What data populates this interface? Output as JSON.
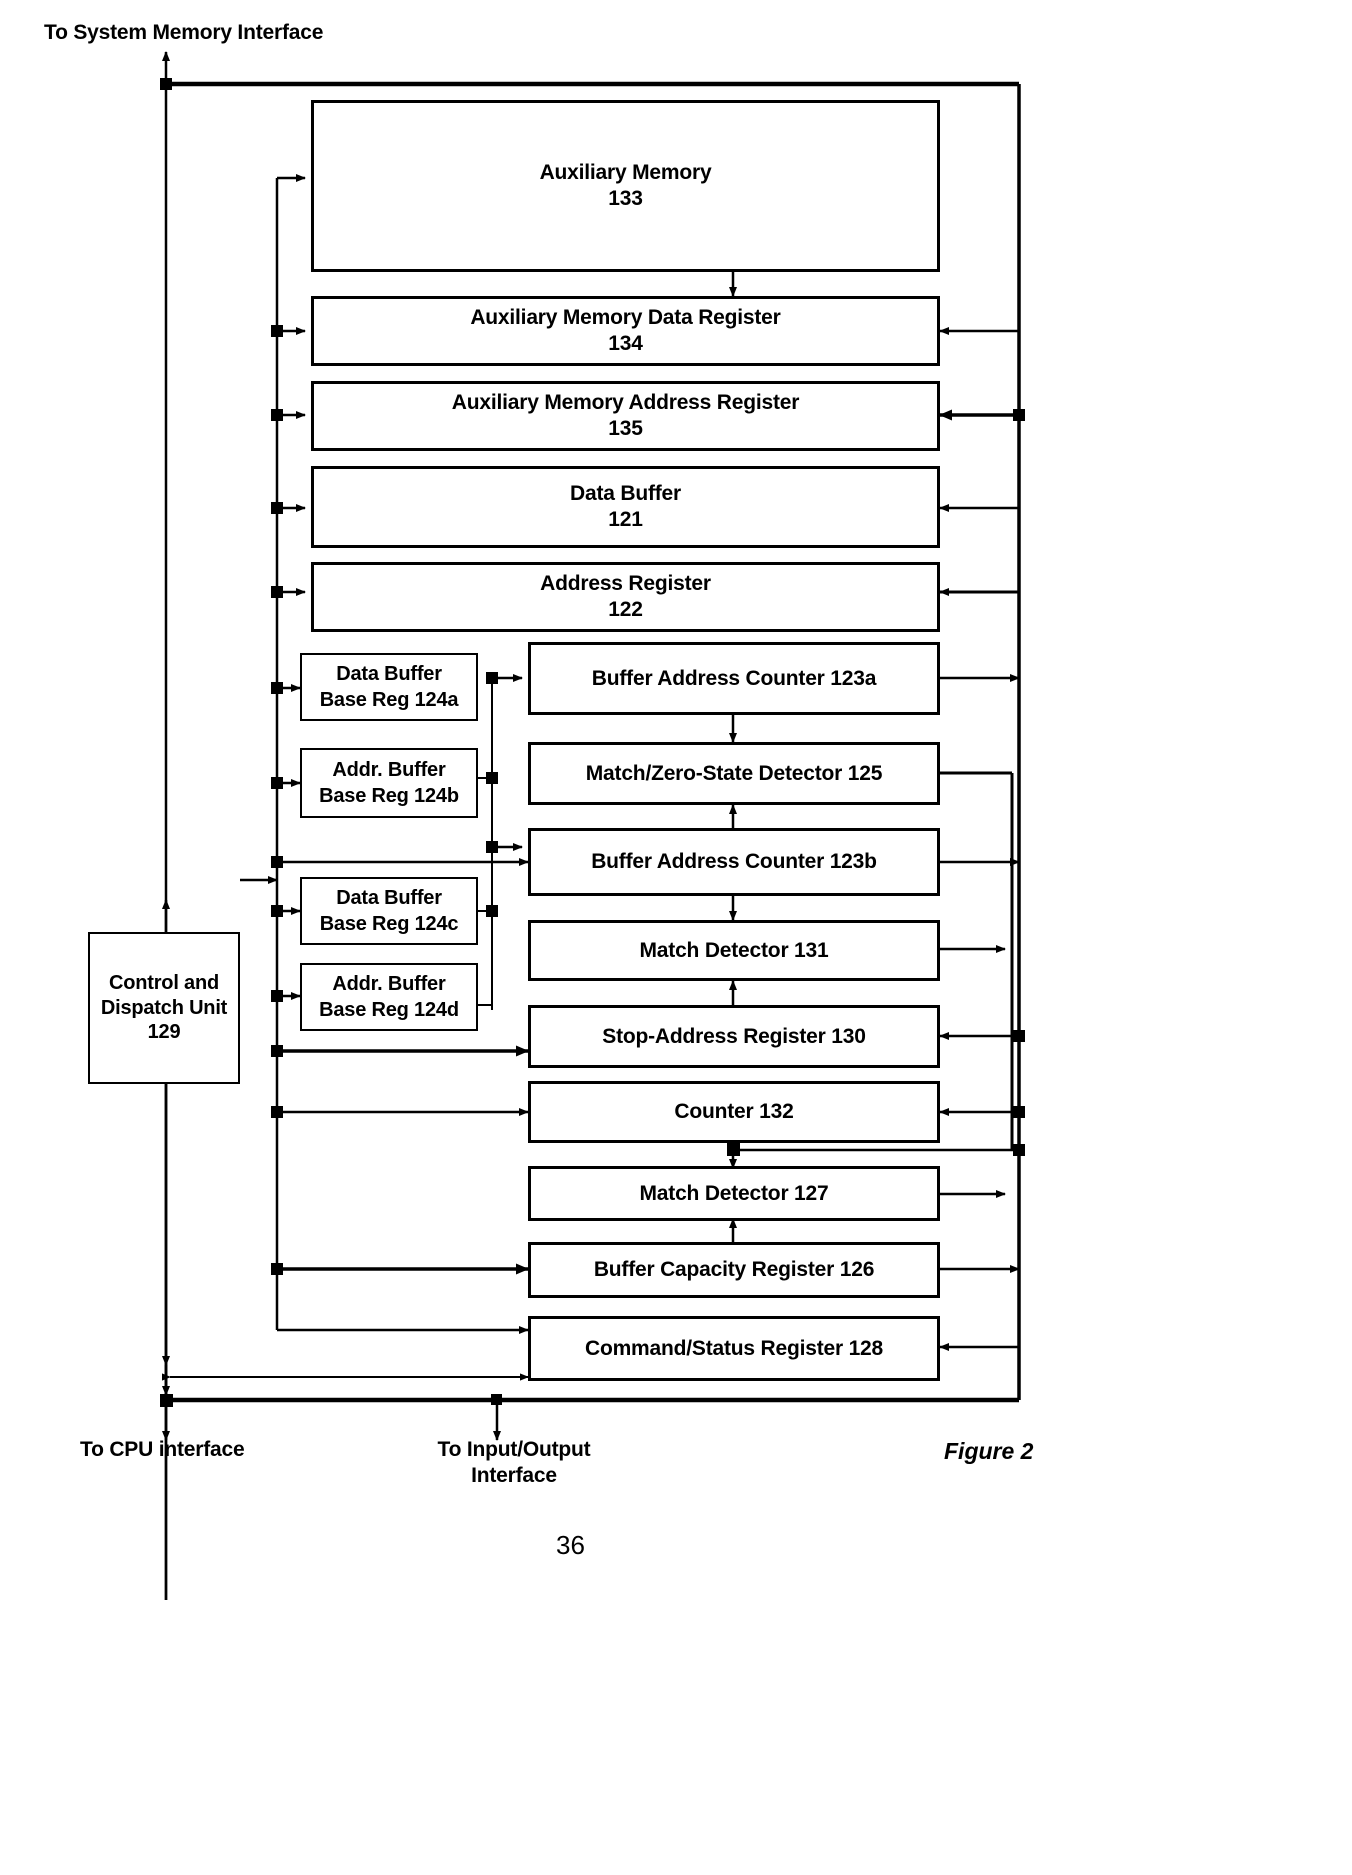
{
  "figure": {
    "caption": "Figure 2",
    "page_number": "36"
  },
  "interface_labels": {
    "top": "To System Memory Interface",
    "bottom_left": "To CPU interface",
    "bottom_mid": "To Input/Output\nInterface"
  },
  "blocks": [
    {
      "id": "aux_memory",
      "title": "Auxiliary Memory",
      "ref": "133"
    },
    {
      "id": "aux_data_reg",
      "title": "Auxiliary Memory Data Register",
      "ref": "134"
    },
    {
      "id": "aux_addr_reg",
      "title": "Auxiliary Memory Address Register",
      "ref": "135"
    },
    {
      "id": "data_buffer",
      "title": "Data Buffer",
      "ref": "121"
    },
    {
      "id": "address_reg",
      "title": "Address Register",
      "ref": "122"
    },
    {
      "id": "bac_123a",
      "title": "Buffer Address Counter 123a",
      "ref": ""
    },
    {
      "id": "mzs_detector",
      "title": "Match/Zero-State Detector 125",
      "ref": ""
    },
    {
      "id": "bac_123b",
      "title": "Buffer Address Counter  123b",
      "ref": ""
    },
    {
      "id": "match_131",
      "title": "Match Detector 131",
      "ref": ""
    },
    {
      "id": "stop_addr_130",
      "title": "Stop-Address Register 130",
      "ref": ""
    },
    {
      "id": "counter_132",
      "title": "Counter 132",
      "ref": ""
    },
    {
      "id": "match_127",
      "title": "Match Detector 127",
      "ref": ""
    },
    {
      "id": "buf_cap_126",
      "title": "Buffer Capacity Register 126",
      "ref": ""
    },
    {
      "id": "cmd_status_128",
      "title": "Command/Status Register 128",
      "ref": ""
    }
  ],
  "control_unit": {
    "line1": "Control and",
    "line2": "Dispatch Unit",
    "ref": "129"
  },
  "base_registers": [
    {
      "id": "reg_124a",
      "line1": "Data Buffer",
      "line2": "Base Reg 124a"
    },
    {
      "id": "reg_124b",
      "line1": "Addr.  Buffer",
      "line2": "Base Reg 124b"
    },
    {
      "id": "reg_124c",
      "line1": "Data Buffer",
      "line2": "Base Reg 124c"
    },
    {
      "id": "reg_124d",
      "line1": "Addr.  Buffer",
      "line2": "Base Reg 124d"
    }
  ],
  "colors": {
    "line": "#000000",
    "background": "#ffffff"
  }
}
